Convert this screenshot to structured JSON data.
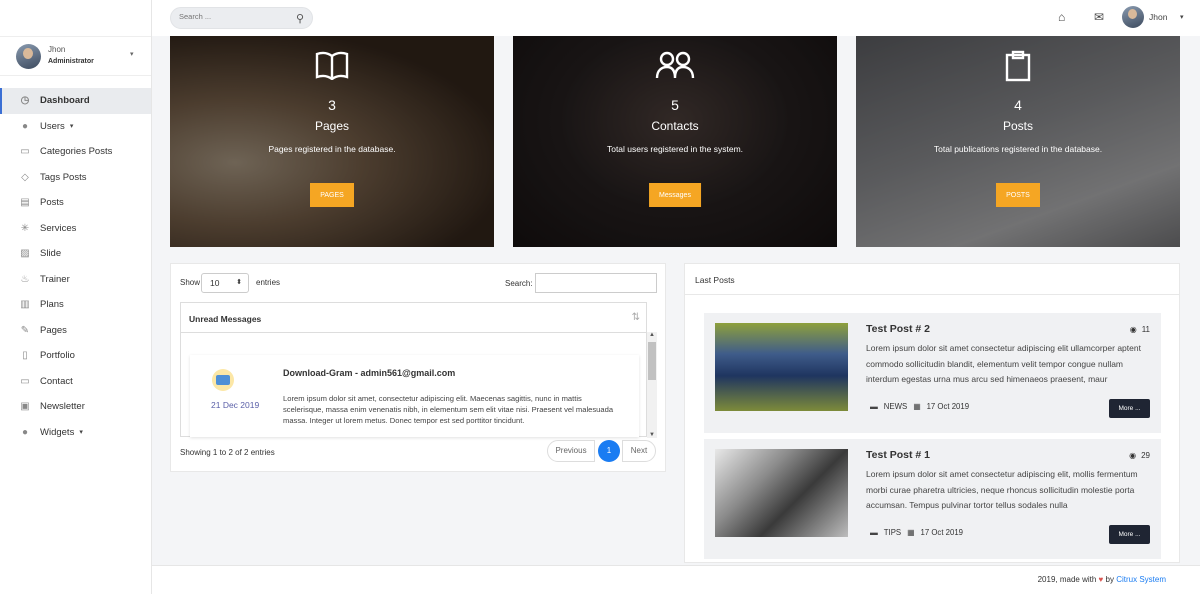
{
  "user": {
    "name": "Jhon",
    "role": "Administrator"
  },
  "search": {
    "placeholder": "Search ..."
  },
  "menu": [
    {
      "label": "Dashboard",
      "icon": "dashboard-icon"
    },
    {
      "label": "Users",
      "icon": "user-icon"
    },
    {
      "label": "Categories Posts",
      "icon": "comments-icon"
    },
    {
      "label": "Tags Posts",
      "icon": "tag-icon"
    },
    {
      "label": "Posts",
      "icon": "newspaper-icon"
    },
    {
      "label": "Services",
      "icon": "asterisk-icon"
    },
    {
      "label": "Slide",
      "icon": "image-icon"
    },
    {
      "label": "Trainer",
      "icon": "fire-icon"
    },
    {
      "label": "Plans",
      "icon": "book-icon"
    },
    {
      "label": "Pages",
      "icon": "pencil-icon"
    },
    {
      "label": "Portfolio",
      "icon": "file-icon"
    },
    {
      "label": "Contact",
      "icon": "comments-icon"
    },
    {
      "label": "Newsletter",
      "icon": "newsletter-icon"
    },
    {
      "label": "Widgets",
      "icon": "user-icon"
    }
  ],
  "cards": [
    {
      "count": "3",
      "label": "Pages",
      "desc": "Pages registered in the database.",
      "button": "PAGES",
      "icon": "book-icon"
    },
    {
      "count": "5",
      "label": "Contacts",
      "desc": "Total users registered in the system.",
      "button": "Messages",
      "icon": "users-icon"
    },
    {
      "count": "4",
      "label": "Posts",
      "desc": "Total publications registered in the database.",
      "button": "POSTS",
      "icon": "clipboard-icon"
    }
  ],
  "messages": {
    "show_label": "Show",
    "entries_value": "10",
    "entries_label": "entries",
    "search_label": "Search:",
    "column": "Unread Messages",
    "item": {
      "date": "21 Dec 2019",
      "from": "Download-Gram - admin561@gmail.com",
      "body": "Lorem ipsum dolor sit amet, consectetur adipiscing elit. Maecenas sagittis, nunc in mattis scelerisque, massa enim venenatis nibh, in elementum sem elit vitae nisi. Praesent vel malesuada massa. Integer ut lorem metus. Donec tempor est sed porttitor tincidunt."
    },
    "showing": "Showing 1 to 2 of 2 entries",
    "prev": "Previous",
    "page": "1",
    "next": "Next"
  },
  "last_posts": {
    "title": "Last Posts",
    "items": [
      {
        "title": "Test Post # 2",
        "views": "11",
        "body": "Lorem ipsum dolor sit amet consectetur adipiscing elit ullamcorper aptent commodo sollicitudin blandit, elementum velit tempor congue nullam interdum egestas urna mus arcu sed himenaeos praesent, maur",
        "category": "NEWS",
        "date": "17 Oct 2019",
        "more": "More ..."
      },
      {
        "title": "Test Post # 1",
        "views": "29",
        "body": "Lorem ipsum dolor sit amet consectetur adipiscing elit, mollis fermentum morbi curae pharetra ultricies, neque rhoncus sollicitudin molestie porta accumsan. Tempus pulvinar tortor tellus sodales nulla",
        "category": "TIPS",
        "date": "17 Oct 2019",
        "more": "More ..."
      }
    ]
  },
  "footer": {
    "prefix": "2019, made with",
    "by": "by",
    "brand": "Citrux System"
  },
  "colors": {
    "accent": "#f5a623",
    "primary": "#1a7cf2",
    "dark_button": "#1f2533"
  }
}
